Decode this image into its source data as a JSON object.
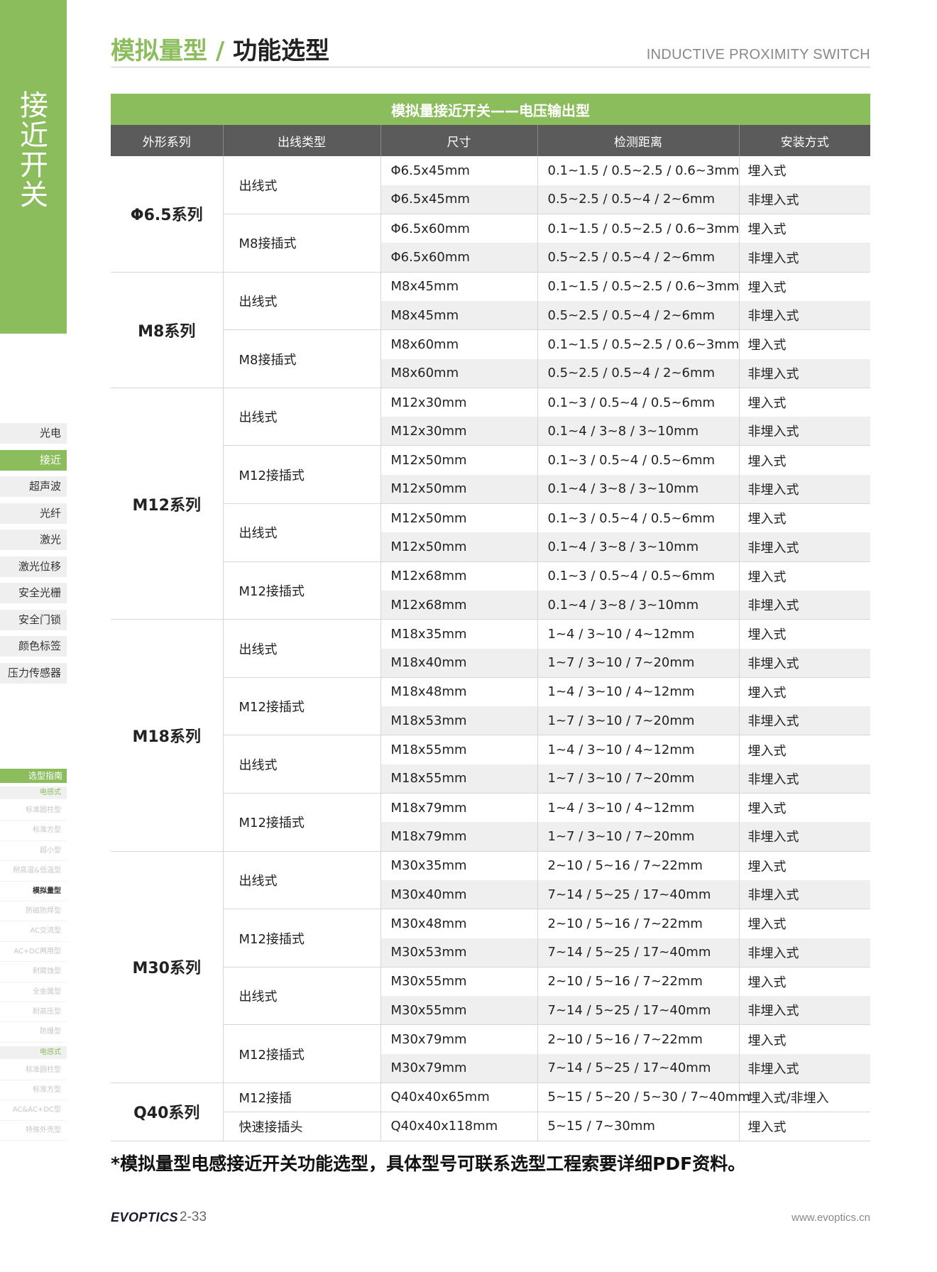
{
  "side": {
    "vertical_title": "接近开关",
    "nav": [
      "光电",
      "接近",
      "超声波",
      "光纤",
      "激光",
      "激光位移",
      "安全光栅",
      "安全门锁",
      "颜色标签",
      "压力传感器"
    ],
    "nav_active_index": 1,
    "guide_title": "选型指南",
    "guide_items": [
      {
        "label": "电感式",
        "type": "section"
      },
      {
        "label": "标准圆柱型",
        "type": "item"
      },
      {
        "label": "标准方型",
        "type": "item"
      },
      {
        "label": "超小型",
        "type": "item"
      },
      {
        "label": "耐高温&低温型",
        "type": "item"
      },
      {
        "label": "模拟量型",
        "type": "current"
      },
      {
        "label": "防磁防焊型",
        "type": "item"
      },
      {
        "label": "AC交流型",
        "type": "item"
      },
      {
        "label": "AC+DC两用型",
        "type": "item"
      },
      {
        "label": "耐腐蚀型",
        "type": "item"
      },
      {
        "label": "全金属型",
        "type": "item"
      },
      {
        "label": "耐高压型",
        "type": "item"
      },
      {
        "label": "防爆型",
        "type": "item"
      },
      {
        "label": "电感式",
        "type": "section"
      },
      {
        "label": "标准圆柱型",
        "type": "item"
      },
      {
        "label": "标准方型",
        "type": "item"
      },
      {
        "label": "AC&AC+DC型",
        "type": "item"
      },
      {
        "label": "特殊外壳型",
        "type": "item"
      }
    ]
  },
  "header": {
    "title_green": "模拟量型",
    "title_sep": " / ",
    "title_black": "功能选型",
    "subtitle": "INDUCTIVE PROXIMITY SWITCH"
  },
  "table": {
    "caption": "模拟量接近开关——电压输出型",
    "headers": [
      "外形系列",
      "出线类型",
      "尺寸",
      "检测距离",
      "安装方式"
    ],
    "series": [
      {
        "name": "Φ6.5系列",
        "groups": [
          {
            "wire": "出线式",
            "rows": [
              [
                "Φ6.5x45mm",
                "0.1~1.5 / 0.5~2.5 / 0.6~3mm",
                "埋入式"
              ],
              [
                "Φ6.5x45mm",
                "0.5~2.5 / 0.5~4 / 2~6mm",
                "非埋入式"
              ]
            ]
          },
          {
            "wire": "M8接插式",
            "rows": [
              [
                "Φ6.5x60mm",
                "0.1~1.5 / 0.5~2.5 / 0.6~3mm",
                "埋入式"
              ],
              [
                "Φ6.5x60mm",
                "0.5~2.5 / 0.5~4 / 2~6mm",
                "非埋入式"
              ]
            ]
          }
        ]
      },
      {
        "name": "M8系列",
        "groups": [
          {
            "wire": "出线式",
            "rows": [
              [
                "M8x45mm",
                "0.1~1.5 / 0.5~2.5 / 0.6~3mm",
                "埋入式"
              ],
              [
                "M8x45mm",
                "0.5~2.5 / 0.5~4 / 2~6mm",
                "非埋入式"
              ]
            ]
          },
          {
            "wire": "M8接插式",
            "rows": [
              [
                "M8x60mm",
                "0.1~1.5 / 0.5~2.5 / 0.6~3mm",
                "埋入式"
              ],
              [
                "M8x60mm",
                "0.5~2.5 / 0.5~4 / 2~6mm",
                "非埋入式"
              ]
            ]
          }
        ]
      },
      {
        "name": "M12系列",
        "groups": [
          {
            "wire": "出线式",
            "rows": [
              [
                "M12x30mm",
                "0.1~3 / 0.5~4 / 0.5~6mm",
                "埋入式"
              ],
              [
                "M12x30mm",
                "0.1~4 / 3~8 / 3~10mm",
                "非埋入式"
              ]
            ]
          },
          {
            "wire": "M12接插式",
            "rows": [
              [
                "M12x50mm",
                "0.1~3 / 0.5~4 / 0.5~6mm",
                "埋入式"
              ],
              [
                "M12x50mm",
                "0.1~4 / 3~8 / 3~10mm",
                "非埋入式"
              ]
            ]
          },
          {
            "wire": "出线式",
            "rows": [
              [
                "M12x50mm",
                "0.1~3 / 0.5~4 / 0.5~6mm",
                "埋入式"
              ],
              [
                "M12x50mm",
                "0.1~4 / 3~8 / 3~10mm",
                "非埋入式"
              ]
            ]
          },
          {
            "wire": "M12接插式",
            "rows": [
              [
                "M12x68mm",
                "0.1~3 / 0.5~4 / 0.5~6mm",
                "埋入式"
              ],
              [
                "M12x68mm",
                "0.1~4 / 3~8 / 3~10mm",
                "非埋入式"
              ]
            ]
          }
        ]
      },
      {
        "name": "M18系列",
        "groups": [
          {
            "wire": "出线式",
            "rows": [
              [
                "M18x35mm",
                "1~4 / 3~10 / 4~12mm",
                "埋入式"
              ],
              [
                "M18x40mm",
                "1~7 / 3~10 / 7~20mm",
                "非埋入式"
              ]
            ]
          },
          {
            "wire": "M12接插式",
            "rows": [
              [
                "M18x48mm",
                "1~4 / 3~10 / 4~12mm",
                "埋入式"
              ],
              [
                "M18x53mm",
                "1~7 / 3~10 / 7~20mm",
                "非埋入式"
              ]
            ]
          },
          {
            "wire": "出线式",
            "rows": [
              [
                "M18x55mm",
                "1~4 / 3~10 / 4~12mm",
                "埋入式"
              ],
              [
                "M18x55mm",
                "1~7 / 3~10 / 7~20mm",
                "非埋入式"
              ]
            ]
          },
          {
            "wire": "M12接插式",
            "rows": [
              [
                "M18x79mm",
                "1~4 / 3~10 / 4~12mm",
                "埋入式"
              ],
              [
                "M18x79mm",
                "1~7 / 3~10 / 7~20mm",
                "非埋入式"
              ]
            ]
          }
        ]
      },
      {
        "name": "M30系列",
        "groups": [
          {
            "wire": "出线式",
            "rows": [
              [
                "M30x35mm",
                "2~10 / 5~16 / 7~22mm",
                "埋入式"
              ],
              [
                "M30x40mm",
                "7~14 / 5~25 / 17~40mm",
                "非埋入式"
              ]
            ]
          },
          {
            "wire": "M12接插式",
            "rows": [
              [
                "M30x48mm",
                "2~10 / 5~16 / 7~22mm",
                "埋入式"
              ],
              [
                "M30x53mm",
                "7~14 / 5~25 / 17~40mm",
                "非埋入式"
              ]
            ]
          },
          {
            "wire": "出线式",
            "rows": [
              [
                "M30x55mm",
                "2~10 / 5~16 / 7~22mm",
                "埋入式"
              ],
              [
                "M30x55mm",
                "7~14 / 5~25 / 17~40mm",
                "非埋入式"
              ]
            ]
          },
          {
            "wire": "M12接插式",
            "rows": [
              [
                "M30x79mm",
                "2~10 / 5~16 / 7~22mm",
                "埋入式"
              ],
              [
                "M30x79mm",
                "7~14 / 5~25 / 17~40mm",
                "非埋入式"
              ]
            ]
          }
        ]
      },
      {
        "name": "Q40系列",
        "groups": [
          {
            "wire": "M12接插",
            "rows": [
              [
                "Q40x40x65mm",
                "5~15 / 5~20 / 5~30 / 7~40mm",
                "埋入式/非埋入"
              ]
            ]
          },
          {
            "wire": "快速接插头",
            "rows": [
              [
                "Q40x40x118mm",
                "5~15 / 7~30mm",
                "埋入式"
              ]
            ]
          }
        ]
      }
    ]
  },
  "footnote": "*模拟量型电感接近开关功能选型，具体型号可联系选型工程索要详细PDF资料。",
  "footer": {
    "brand": "EVOPTICS",
    "page": "2-33",
    "url": "www.evoptics.cn"
  },
  "colors": {
    "accent_green": "#8cbd5c",
    "header_gray": "#5b5b5b",
    "row_alt": "#efefef"
  }
}
